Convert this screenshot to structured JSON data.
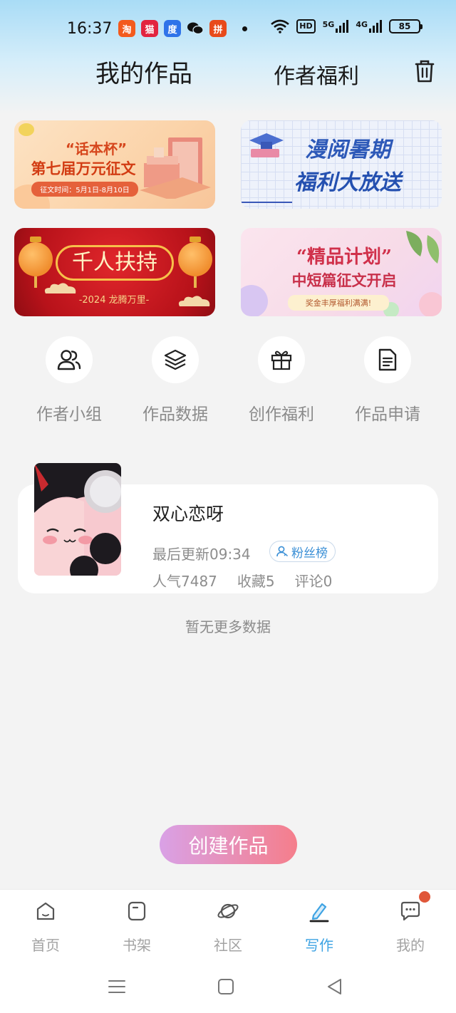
{
  "status_bar": {
    "time": "16:37",
    "apps": [
      {
        "icon": "taobao-app-icon",
        "glyph": "淘",
        "color": "#f35a1d"
      },
      {
        "icon": "tmall-app-icon",
        "glyph": "猫",
        "color": "#e2243f"
      },
      {
        "icon": "baidu-app-icon",
        "glyph": "度",
        "color": "#2f73e9"
      },
      {
        "icon": "wechat-app-icon",
        "glyph": "",
        "color": "#111111"
      },
      {
        "icon": "pinduoduo-app-icon",
        "glyph": "拼",
        "color": "#e84a1b"
      }
    ],
    "hd_label": "HD",
    "net1": "5G",
    "net2": "4G",
    "battery": "85"
  },
  "header": {
    "title": "我的作品",
    "welfare_tab": "作者福利",
    "trash_icon": "trash-icon"
  },
  "banners": [
    {
      "name": "banner-huaben-cup",
      "line1": "“话本杯”",
      "line2": "第七届万元征文",
      "line3": "征文时间：5月1日-8月10日"
    },
    {
      "name": "banner-summer-welfare",
      "line1": "漫阅暑期",
      "line2": "福利大放送"
    },
    {
      "name": "banner-thousand-support",
      "line1": "千人扶持",
      "line2": "-2024 龙腾万里-"
    },
    {
      "name": "banner-quality-plan",
      "line1": "“精品计划”",
      "line2": "中短篇征文开启",
      "line3": "奖金丰厚福利满满!"
    }
  ],
  "quick_menu": [
    {
      "label": "作者小组",
      "icon": "author-group-icon"
    },
    {
      "label": "作品数据",
      "icon": "layers-data-icon"
    },
    {
      "label": "创作福利",
      "icon": "gift-icon"
    },
    {
      "label": "作品申请",
      "icon": "document-apply-icon"
    }
  ],
  "work": {
    "title": "双心恋呀",
    "last_update_label": "最后更新09:34",
    "fans_badge": "粉丝榜",
    "popularity": "人气7487",
    "favorites": "收藏5",
    "comments": "评论0"
  },
  "no_more": "暂无更多数据",
  "create_button": "创建作品",
  "tabs": [
    {
      "label": "首页",
      "icon": "home-icon",
      "active": false
    },
    {
      "label": "书架",
      "icon": "bookshelf-icon",
      "active": false
    },
    {
      "label": "社区",
      "icon": "planet-community-icon",
      "active": false
    },
    {
      "label": "写作",
      "icon": "pen-write-icon",
      "active": true
    },
    {
      "label": "我的",
      "icon": "chat-bubble-icon",
      "active": false
    }
  ],
  "colors": {
    "accent": "#3ea3e3",
    "create_gradient_start": "#d9a1e6",
    "create_gradient_end": "#f57e8b",
    "notification_dot": "#e0573a"
  }
}
